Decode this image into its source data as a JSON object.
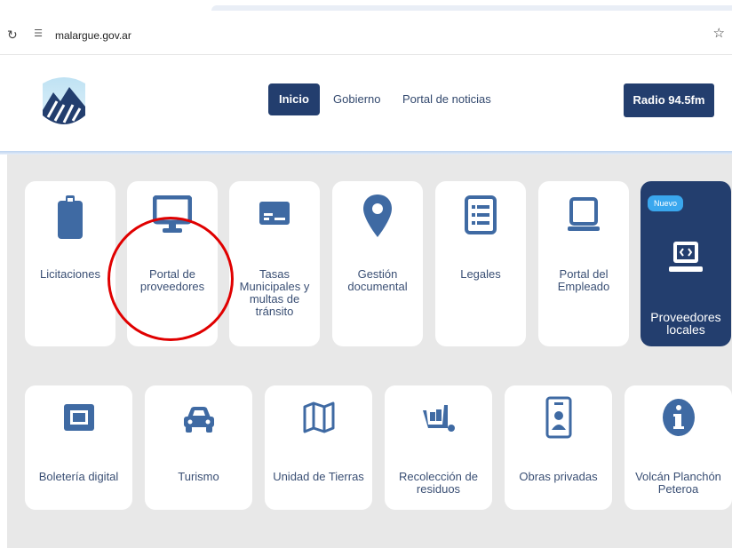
{
  "browser": {
    "url": "malargue.gov.ar"
  },
  "header": {
    "nav": [
      {
        "label": "Inicio",
        "active": true
      },
      {
        "label": "Gobierno",
        "active": false
      },
      {
        "label": "Portal de noticias",
        "active": false
      }
    ],
    "radio_label": "Radio 94.5fm"
  },
  "colors": {
    "brand_navy": "#233e6e",
    "icon_blue": "#3f6aa3",
    "badge_blue": "#3aa7ee",
    "annotation_red": "#e00000"
  },
  "cards_row1": [
    {
      "label": "Licitaciones",
      "icon": "clipboard-icon"
    },
    {
      "label": "Portal de proveedores",
      "icon": "monitor-icon"
    },
    {
      "label": "Tasas Municipales y multas de tránsito",
      "icon": "card-icon"
    },
    {
      "label": "Gestión documental",
      "icon": "map-pin-icon"
    },
    {
      "label": "Legales",
      "icon": "list-document-icon"
    },
    {
      "label": "Portal del Empleado",
      "icon": "laptop-icon"
    },
    {
      "label": "Proveedores locales",
      "icon": "code-laptop-icon",
      "badge": "Nuevo"
    }
  ],
  "cards_row2": [
    {
      "label": "Boletería digital",
      "icon": "ticket-icon"
    },
    {
      "label": "Turismo",
      "icon": "car-icon"
    },
    {
      "label": "Unidad de Tierras",
      "icon": "map-icon"
    },
    {
      "label": "Recolección de residuos",
      "icon": "dumpster-icon"
    },
    {
      "label": "Obras privadas",
      "icon": "id-badge-icon"
    },
    {
      "label": "Volcán Planchón Peteroa",
      "icon": "info-icon"
    }
  ]
}
